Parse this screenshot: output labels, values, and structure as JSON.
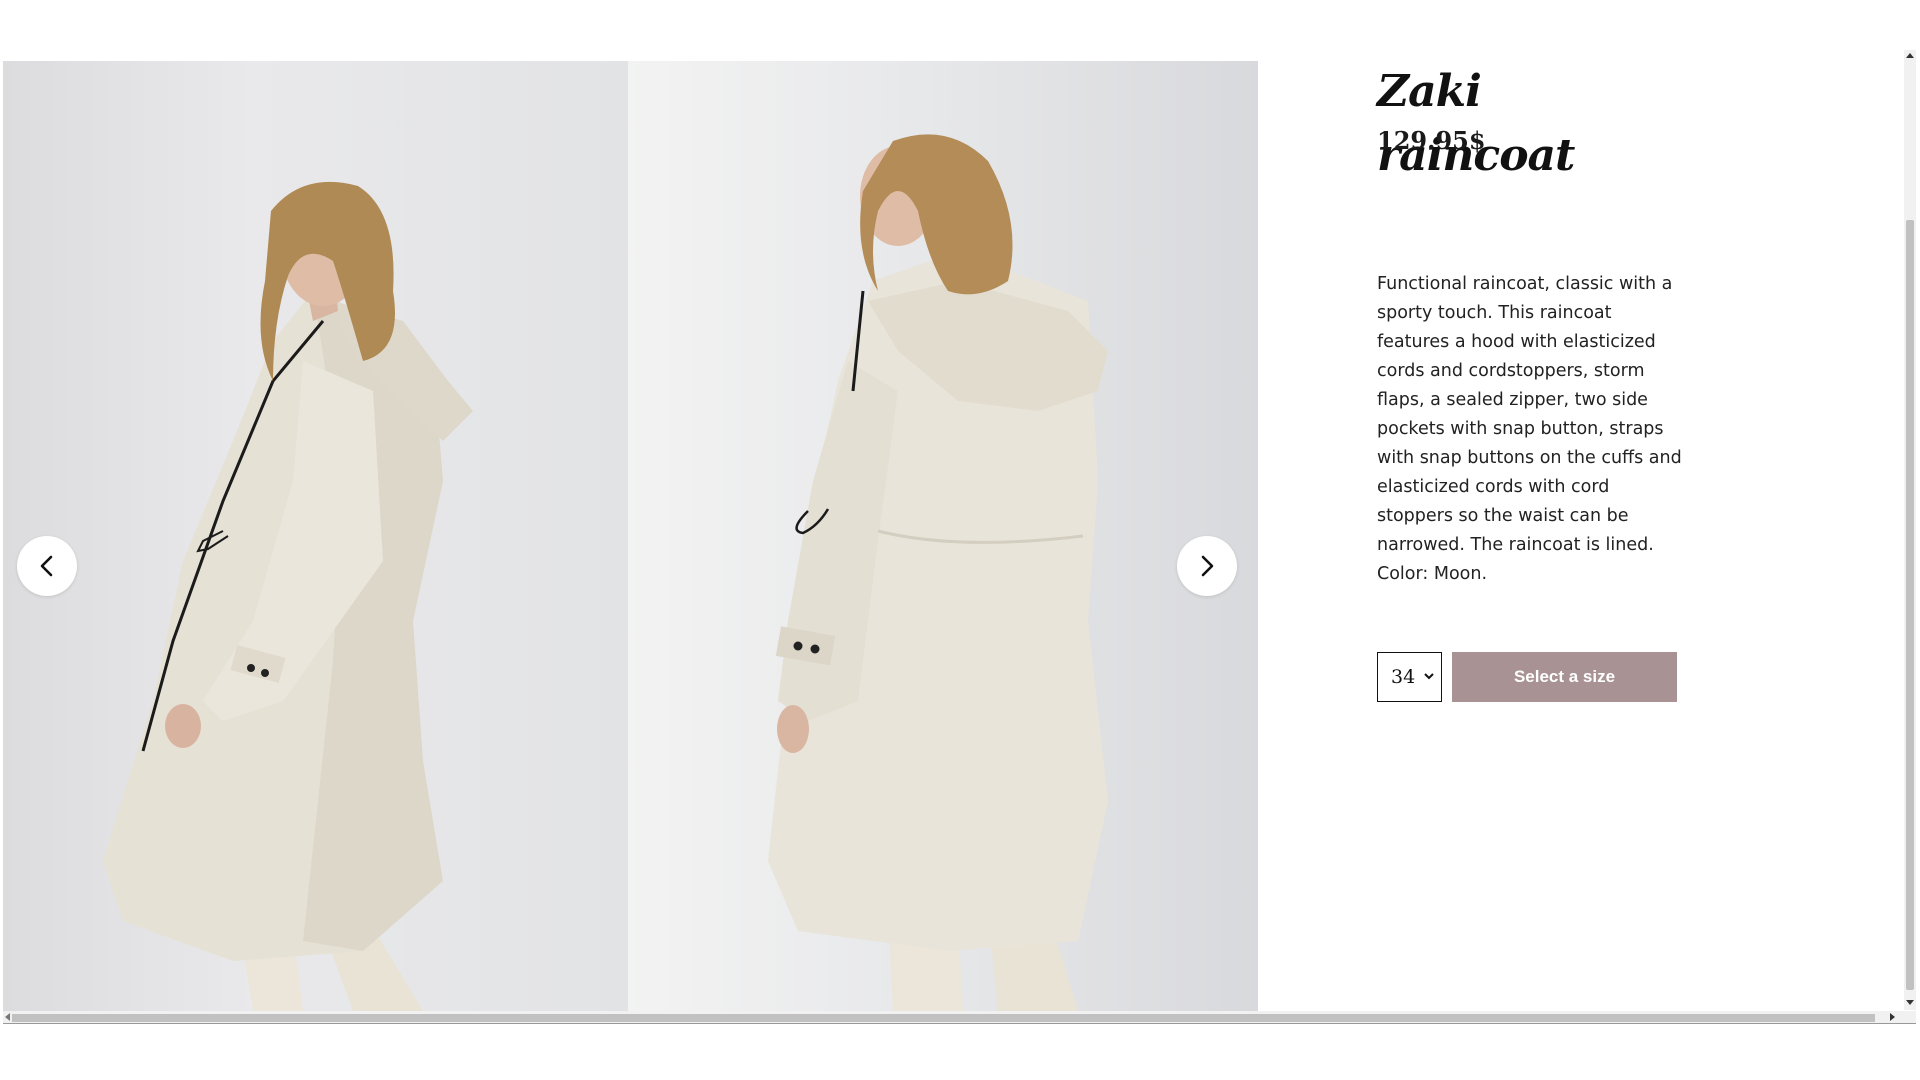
{
  "product": {
    "title": "Zaki raincoat",
    "price": "129.95$",
    "description": "Functional raincoat, classic with a sporty touch. This raincoat features a hood with elasticized cords and cordstoppers, storm flaps, a sealed zipper, two side pockets with snap button, straps with snap buttons on the cuffs and elasticized cords with cord stoppers so the waist can be narrowed. The raincoat is lined. Color: Moon.",
    "size_selected": "34",
    "select_button_label": "Select a size"
  },
  "gallery": {
    "prev_icon": "chevron-left-icon",
    "next_icon": "chevron-right-icon"
  },
  "colors": {
    "button": "#a89294",
    "coat": "#e8e3d8",
    "background": "#ffffff"
  }
}
